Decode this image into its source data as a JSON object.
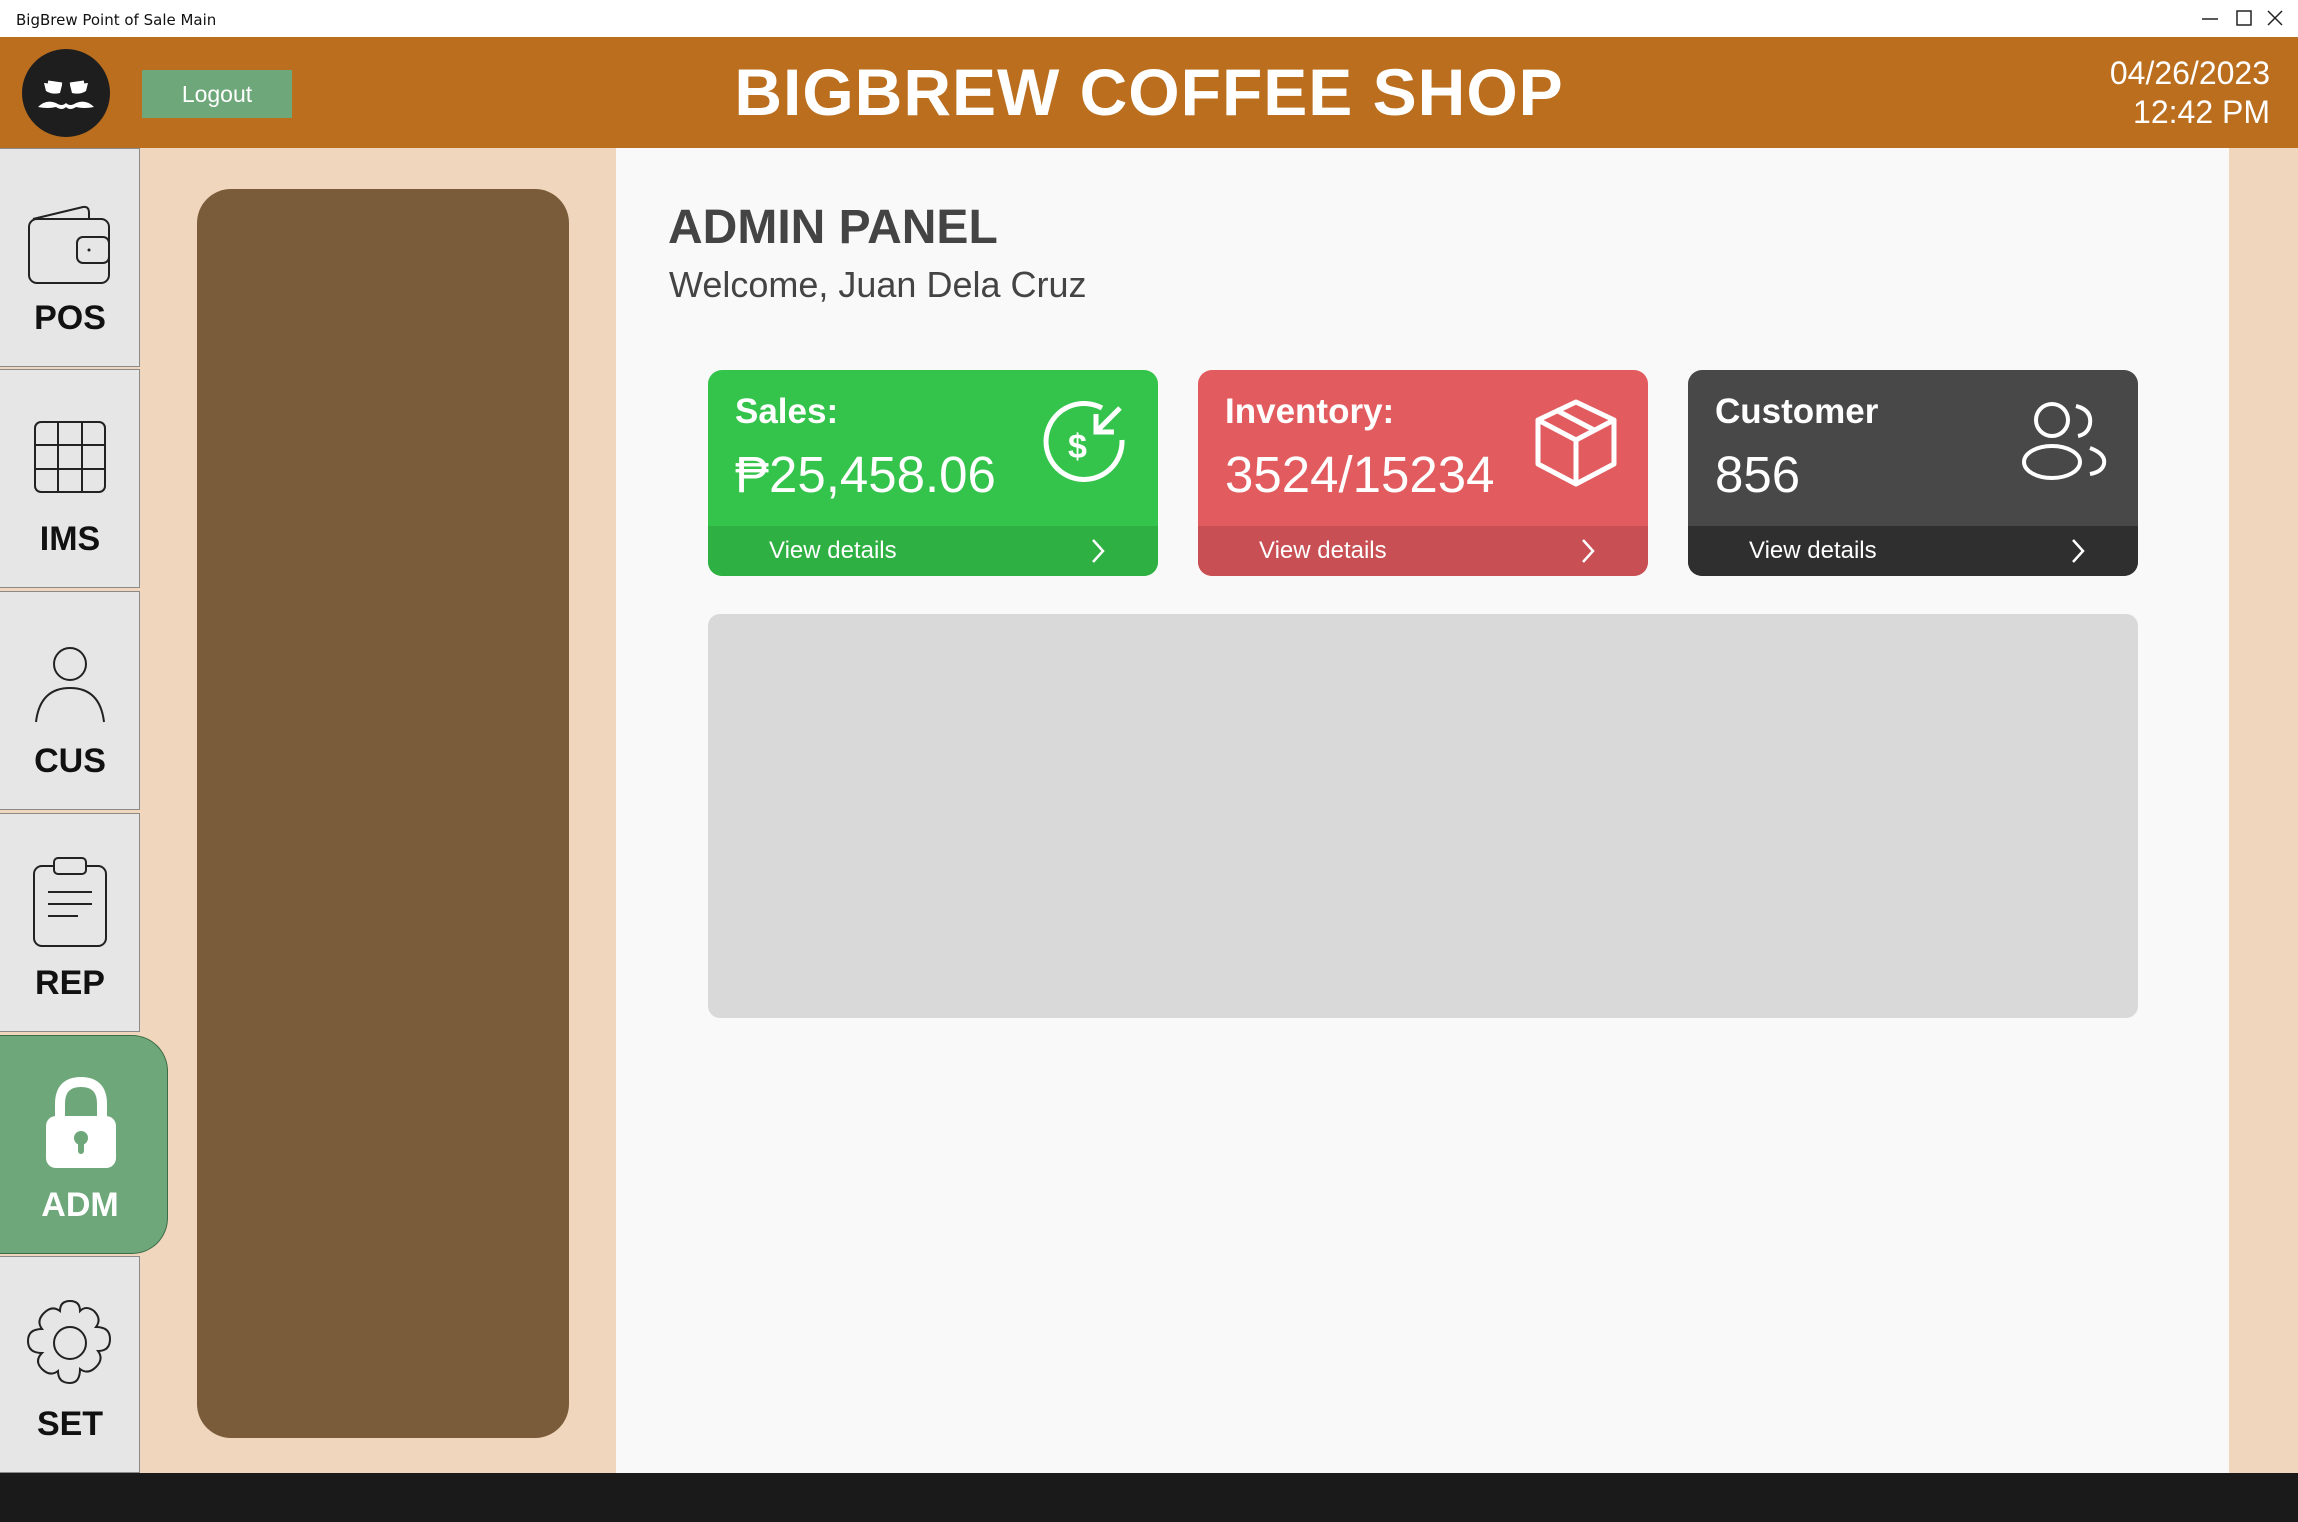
{
  "window": {
    "title": "BigBrew Point of Sale Main"
  },
  "header": {
    "shop_name": "BIGBREW COFFEE SHOP",
    "logout_label": "Logout",
    "date": "04/26/2023",
    "time": "12:42 PM",
    "color": "#ba6e1e"
  },
  "nav": {
    "items": [
      {
        "label": "POS",
        "icon": "wallet-icon",
        "active": false
      },
      {
        "label": "IMS",
        "icon": "grid-icon",
        "active": false
      },
      {
        "label": "CUS",
        "icon": "user-icon",
        "active": false
      },
      {
        "label": "REP",
        "icon": "clipboard-icon",
        "active": false
      },
      {
        "label": "ADM",
        "icon": "lock-icon",
        "active": true
      },
      {
        "label": "SET",
        "icon": "gear-icon",
        "active": false
      }
    ]
  },
  "main": {
    "title": "ADMIN PANEL",
    "welcome": "Welcome, Juan Dela Cruz"
  },
  "cards": [
    {
      "title": "Sales:",
      "value": "₱25,458.06",
      "link": "View details",
      "icon": "dollar-refund-icon",
      "color": "#34c44c"
    },
    {
      "title": "Inventory:",
      "value": "3524/15234",
      "link": "View details",
      "icon": "box-icon",
      "color": "#e25b5f"
    },
    {
      "title": "Customer",
      "value": "856",
      "link": "View details",
      "icon": "users-icon",
      "color": "#484848"
    }
  ]
}
